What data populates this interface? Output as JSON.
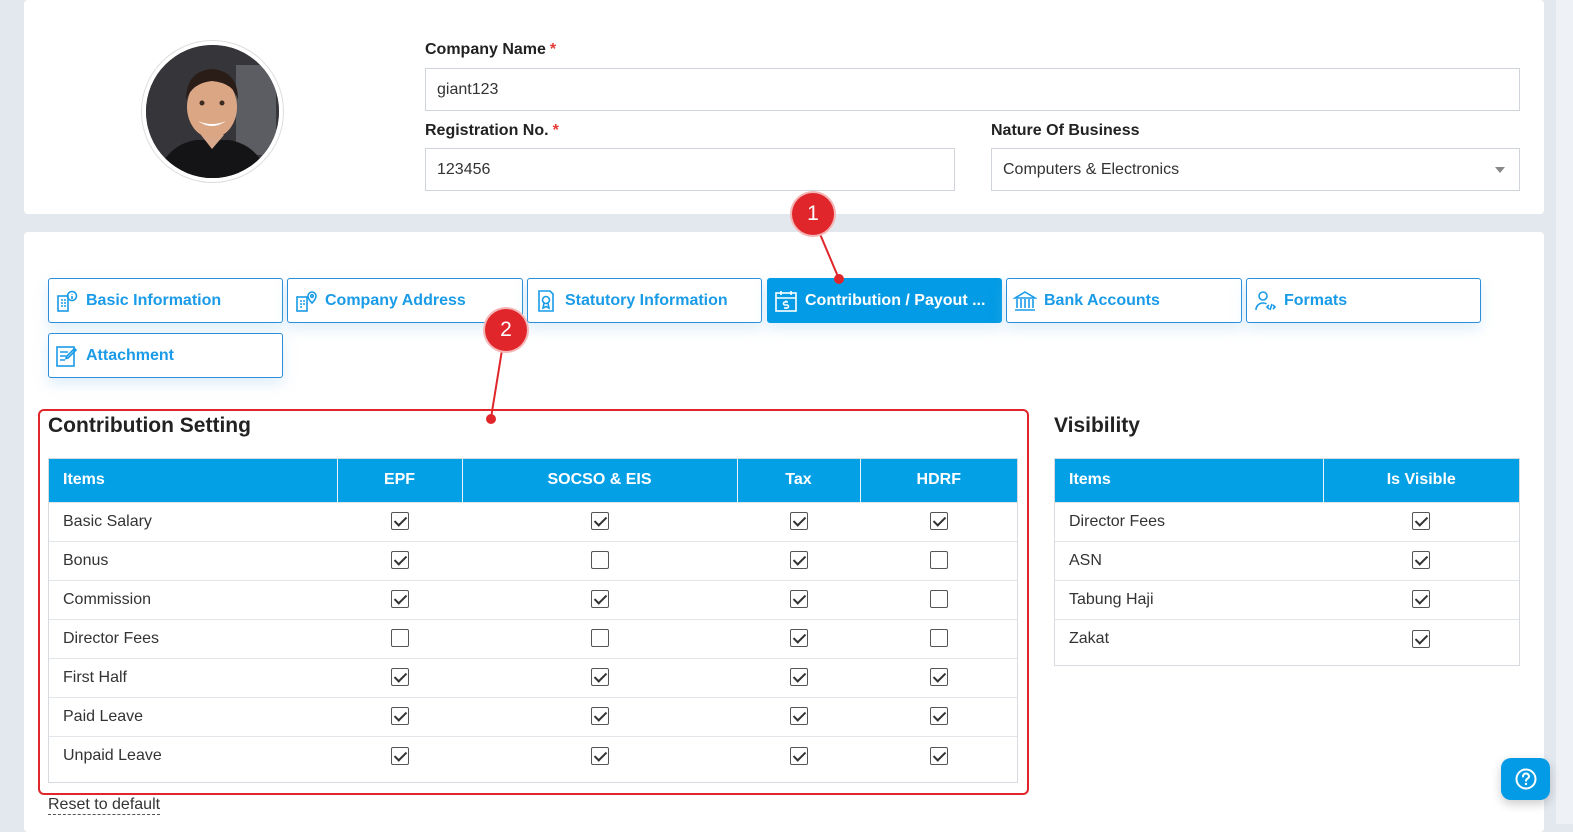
{
  "company": {
    "name_label": "Company Name",
    "name_value": "giant123",
    "reg_label": "Registration No.",
    "reg_value": "123456",
    "nature_label": "Nature Of Business",
    "nature_value": "Computers & Electronics",
    "required_mark": "*"
  },
  "tabs": [
    {
      "label": "Basic Information",
      "icon": "building-info-icon"
    },
    {
      "label": "Company Address",
      "icon": "building-location-icon"
    },
    {
      "label": "Statutory Information",
      "icon": "document-badge-icon"
    },
    {
      "label": "Contribution / Payout ...",
      "icon": "calendar-money-icon",
      "active": true
    },
    {
      "label": "Bank Accounts",
      "icon": "bank-icon"
    },
    {
      "label": "Formats",
      "icon": "user-code-icon"
    },
    {
      "label": "Attachment",
      "icon": "edit-document-icon"
    }
  ],
  "contribution": {
    "title": "Contribution Setting",
    "headers": [
      "Items",
      "EPF",
      "SOCSO & EIS",
      "Tax",
      "HDRF"
    ],
    "rows": [
      {
        "item": "Basic Salary",
        "checks": [
          true,
          true,
          true,
          true
        ]
      },
      {
        "item": "Bonus",
        "checks": [
          true,
          false,
          true,
          false
        ]
      },
      {
        "item": "Commission",
        "checks": [
          true,
          true,
          true,
          false
        ]
      },
      {
        "item": "Director Fees",
        "checks": [
          false,
          false,
          true,
          false
        ]
      },
      {
        "item": "First Half",
        "checks": [
          true,
          true,
          true,
          true
        ]
      },
      {
        "item": "Paid Leave",
        "checks": [
          true,
          true,
          true,
          true
        ]
      },
      {
        "item": "Unpaid Leave",
        "checks": [
          true,
          true,
          true,
          true
        ]
      }
    ],
    "reset_label": "Reset to default"
  },
  "visibility": {
    "title": "Visibility",
    "headers": [
      "Items",
      "Is Visible"
    ],
    "rows": [
      {
        "item": "Director Fees",
        "visible": true
      },
      {
        "item": "ASN",
        "visible": true
      },
      {
        "item": "Tabung Haji",
        "visible": true
      },
      {
        "item": "Zakat",
        "visible": true
      }
    ]
  },
  "annotations": {
    "badge1": "1",
    "badge2": "2",
    "color": "#e0262a"
  },
  "colors": {
    "accent": "#039be5",
    "tab_text": "#1a9be8"
  }
}
